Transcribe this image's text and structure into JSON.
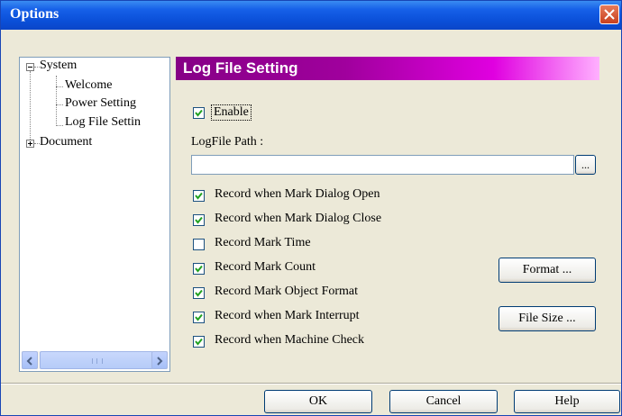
{
  "window": {
    "title": "Options"
  },
  "tree": {
    "system": "System",
    "children": [
      "Welcome",
      "Power Setting",
      "Log File Settin"
    ],
    "document": "Document",
    "scroll_grip": "III"
  },
  "panel": {
    "header": "Log File Setting",
    "enable": {
      "label": "Enable",
      "checked": true
    },
    "path_label": "LogFile Path :",
    "path_value": "",
    "browse_label": "...",
    "options": [
      {
        "label": "Record when Mark Dialog Open",
        "checked": true
      },
      {
        "label": "Record when Mark Dialog Close",
        "checked": true
      },
      {
        "label": "Record Mark Time",
        "checked": false
      },
      {
        "label": "Record Mark Count",
        "checked": true
      },
      {
        "label": "Record Mark Object Format",
        "checked": true
      },
      {
        "label": "Record when Mark Interrupt",
        "checked": true
      },
      {
        "label": "Record when Machine Check",
        "checked": true
      }
    ],
    "format_button": "Format ...",
    "filesize_button": "File Size ..."
  },
  "footer": {
    "ok": "OK",
    "cancel": "Cancel",
    "help": "Help"
  }
}
